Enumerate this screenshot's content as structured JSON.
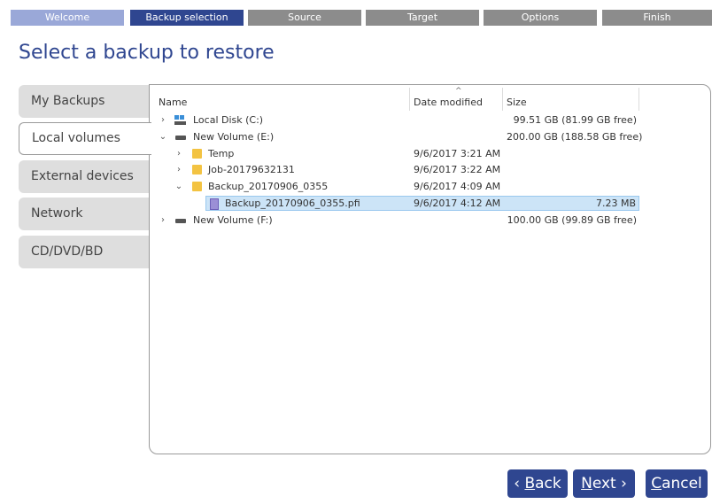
{
  "wizard": {
    "steps": [
      "Welcome",
      "Backup selection",
      "Source",
      "Target",
      "Options",
      "Finish"
    ]
  },
  "page_title": "Select a backup to restore",
  "tabs": [
    "My Backups",
    "Local volumes",
    "External devices",
    "Network",
    "CD/DVD/BD"
  ],
  "columns": {
    "name": "Name",
    "date": "Date modified",
    "size": "Size"
  },
  "sort_indicator": "^",
  "rows": [
    {
      "name": "Local Disk (C:)",
      "date": "",
      "size": "99.51 GB (81.99 GB free)",
      "icon": "windows-drive-icon",
      "expanded": false
    },
    {
      "name": "New Volume (E:)",
      "date": "",
      "size": "200.00 GB (188.58 GB free)",
      "icon": "drive-icon",
      "expanded": true
    },
    {
      "name": "Temp",
      "date": "9/6/2017 3:21 AM",
      "size": "",
      "icon": "folder-icon",
      "expanded": false
    },
    {
      "name": "Job-20179632131",
      "date": "9/6/2017 3:22 AM",
      "size": "",
      "icon": "folder-icon",
      "expanded": false
    },
    {
      "name": "Backup_20170906_0355",
      "date": "9/6/2017 4:09 AM",
      "size": "",
      "icon": "folder-icon",
      "expanded": true
    },
    {
      "name": "Backup_20170906_0355.pfi",
      "date": "9/6/2017 4:12 AM",
      "size": "7.23 MB",
      "icon": "backup-file-icon",
      "selected": true
    },
    {
      "name": "New Volume (F:)",
      "date": "",
      "size": "100.00 GB (99.89 GB free)",
      "icon": "drive-icon",
      "expanded": false
    }
  ],
  "chevrons": {
    "collapsed": "›",
    "expanded": "⌄"
  },
  "buttons": {
    "back_prefix": "‹ ",
    "back_key": "B",
    "back_rest": "ack",
    "next_key": "N",
    "next_rest": "ext",
    "next_suffix": " ›",
    "cancel_key": "C",
    "cancel_rest": "ancel"
  },
  "colors": {
    "accent": "#2f4690",
    "step_done": "#9aa8d8",
    "step_pending": "#8c8c8c",
    "selection": "#cce4f7"
  }
}
